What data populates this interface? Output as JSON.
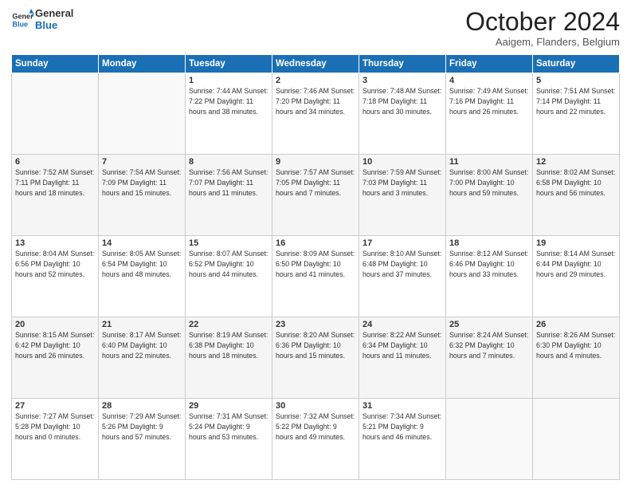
{
  "logo": {
    "line1": "General",
    "line2": "Blue"
  },
  "title": "October 2024",
  "subtitle": "Aaigem, Flanders, Belgium",
  "weekdays": [
    "Sunday",
    "Monday",
    "Tuesday",
    "Wednesday",
    "Thursday",
    "Friday",
    "Saturday"
  ],
  "weeks": [
    [
      {
        "day": "",
        "info": ""
      },
      {
        "day": "",
        "info": ""
      },
      {
        "day": "1",
        "info": "Sunrise: 7:44 AM\nSunset: 7:22 PM\nDaylight: 11 hours and 38 minutes."
      },
      {
        "day": "2",
        "info": "Sunrise: 7:46 AM\nSunset: 7:20 PM\nDaylight: 11 hours and 34 minutes."
      },
      {
        "day": "3",
        "info": "Sunrise: 7:48 AM\nSunset: 7:18 PM\nDaylight: 11 hours and 30 minutes."
      },
      {
        "day": "4",
        "info": "Sunrise: 7:49 AM\nSunset: 7:16 PM\nDaylight: 11 hours and 26 minutes."
      },
      {
        "day": "5",
        "info": "Sunrise: 7:51 AM\nSunset: 7:14 PM\nDaylight: 11 hours and 22 minutes."
      }
    ],
    [
      {
        "day": "6",
        "info": "Sunrise: 7:52 AM\nSunset: 7:11 PM\nDaylight: 11 hours and 18 minutes."
      },
      {
        "day": "7",
        "info": "Sunrise: 7:54 AM\nSunset: 7:09 PM\nDaylight: 11 hours and 15 minutes."
      },
      {
        "day": "8",
        "info": "Sunrise: 7:56 AM\nSunset: 7:07 PM\nDaylight: 11 hours and 11 minutes."
      },
      {
        "day": "9",
        "info": "Sunrise: 7:57 AM\nSunset: 7:05 PM\nDaylight: 11 hours and 7 minutes."
      },
      {
        "day": "10",
        "info": "Sunrise: 7:59 AM\nSunset: 7:03 PM\nDaylight: 11 hours and 3 minutes."
      },
      {
        "day": "11",
        "info": "Sunrise: 8:00 AM\nSunset: 7:00 PM\nDaylight: 10 hours and 59 minutes."
      },
      {
        "day": "12",
        "info": "Sunrise: 8:02 AM\nSunset: 6:58 PM\nDaylight: 10 hours and 56 minutes."
      }
    ],
    [
      {
        "day": "13",
        "info": "Sunrise: 8:04 AM\nSunset: 6:56 PM\nDaylight: 10 hours and 52 minutes."
      },
      {
        "day": "14",
        "info": "Sunrise: 8:05 AM\nSunset: 6:54 PM\nDaylight: 10 hours and 48 minutes."
      },
      {
        "day": "15",
        "info": "Sunrise: 8:07 AM\nSunset: 6:52 PM\nDaylight: 10 hours and 44 minutes."
      },
      {
        "day": "16",
        "info": "Sunrise: 8:09 AM\nSunset: 6:50 PM\nDaylight: 10 hours and 41 minutes."
      },
      {
        "day": "17",
        "info": "Sunrise: 8:10 AM\nSunset: 6:48 PM\nDaylight: 10 hours and 37 minutes."
      },
      {
        "day": "18",
        "info": "Sunrise: 8:12 AM\nSunset: 6:46 PM\nDaylight: 10 hours and 33 minutes."
      },
      {
        "day": "19",
        "info": "Sunrise: 8:14 AM\nSunset: 6:44 PM\nDaylight: 10 hours and 29 minutes."
      }
    ],
    [
      {
        "day": "20",
        "info": "Sunrise: 8:15 AM\nSunset: 6:42 PM\nDaylight: 10 hours and 26 minutes."
      },
      {
        "day": "21",
        "info": "Sunrise: 8:17 AM\nSunset: 6:40 PM\nDaylight: 10 hours and 22 minutes."
      },
      {
        "day": "22",
        "info": "Sunrise: 8:19 AM\nSunset: 6:38 PM\nDaylight: 10 hours and 18 minutes."
      },
      {
        "day": "23",
        "info": "Sunrise: 8:20 AM\nSunset: 6:36 PM\nDaylight: 10 hours and 15 minutes."
      },
      {
        "day": "24",
        "info": "Sunrise: 8:22 AM\nSunset: 6:34 PM\nDaylight: 10 hours and 11 minutes."
      },
      {
        "day": "25",
        "info": "Sunrise: 8:24 AM\nSunset: 6:32 PM\nDaylight: 10 hours and 7 minutes."
      },
      {
        "day": "26",
        "info": "Sunrise: 8:26 AM\nSunset: 6:30 PM\nDaylight: 10 hours and 4 minutes."
      }
    ],
    [
      {
        "day": "27",
        "info": "Sunrise: 7:27 AM\nSunset: 5:28 PM\nDaylight: 10 hours and 0 minutes."
      },
      {
        "day": "28",
        "info": "Sunrise: 7:29 AM\nSunset: 5:26 PM\nDaylight: 9 hours and 57 minutes."
      },
      {
        "day": "29",
        "info": "Sunrise: 7:31 AM\nSunset: 5:24 PM\nDaylight: 9 hours and 53 minutes."
      },
      {
        "day": "30",
        "info": "Sunrise: 7:32 AM\nSunset: 5:22 PM\nDaylight: 9 hours and 49 minutes."
      },
      {
        "day": "31",
        "info": "Sunrise: 7:34 AM\nSunset: 5:21 PM\nDaylight: 9 hours and 46 minutes."
      },
      {
        "day": "",
        "info": ""
      },
      {
        "day": "",
        "info": ""
      }
    ]
  ]
}
